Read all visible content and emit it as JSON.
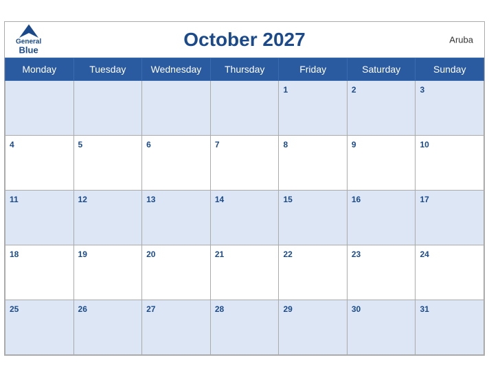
{
  "header": {
    "logo": {
      "general": "General",
      "blue": "Blue",
      "bird_symbol": "▲"
    },
    "title": "October 2027",
    "country": "Aruba"
  },
  "weekdays": [
    "Monday",
    "Tuesday",
    "Wednesday",
    "Thursday",
    "Friday",
    "Saturday",
    "Sunday"
  ],
  "weeks": [
    [
      null,
      null,
      null,
      null,
      1,
      2,
      3
    ],
    [
      4,
      5,
      6,
      7,
      8,
      9,
      10
    ],
    [
      11,
      12,
      13,
      14,
      15,
      16,
      17
    ],
    [
      18,
      19,
      20,
      21,
      22,
      23,
      24
    ],
    [
      25,
      26,
      27,
      28,
      29,
      30,
      31
    ]
  ]
}
